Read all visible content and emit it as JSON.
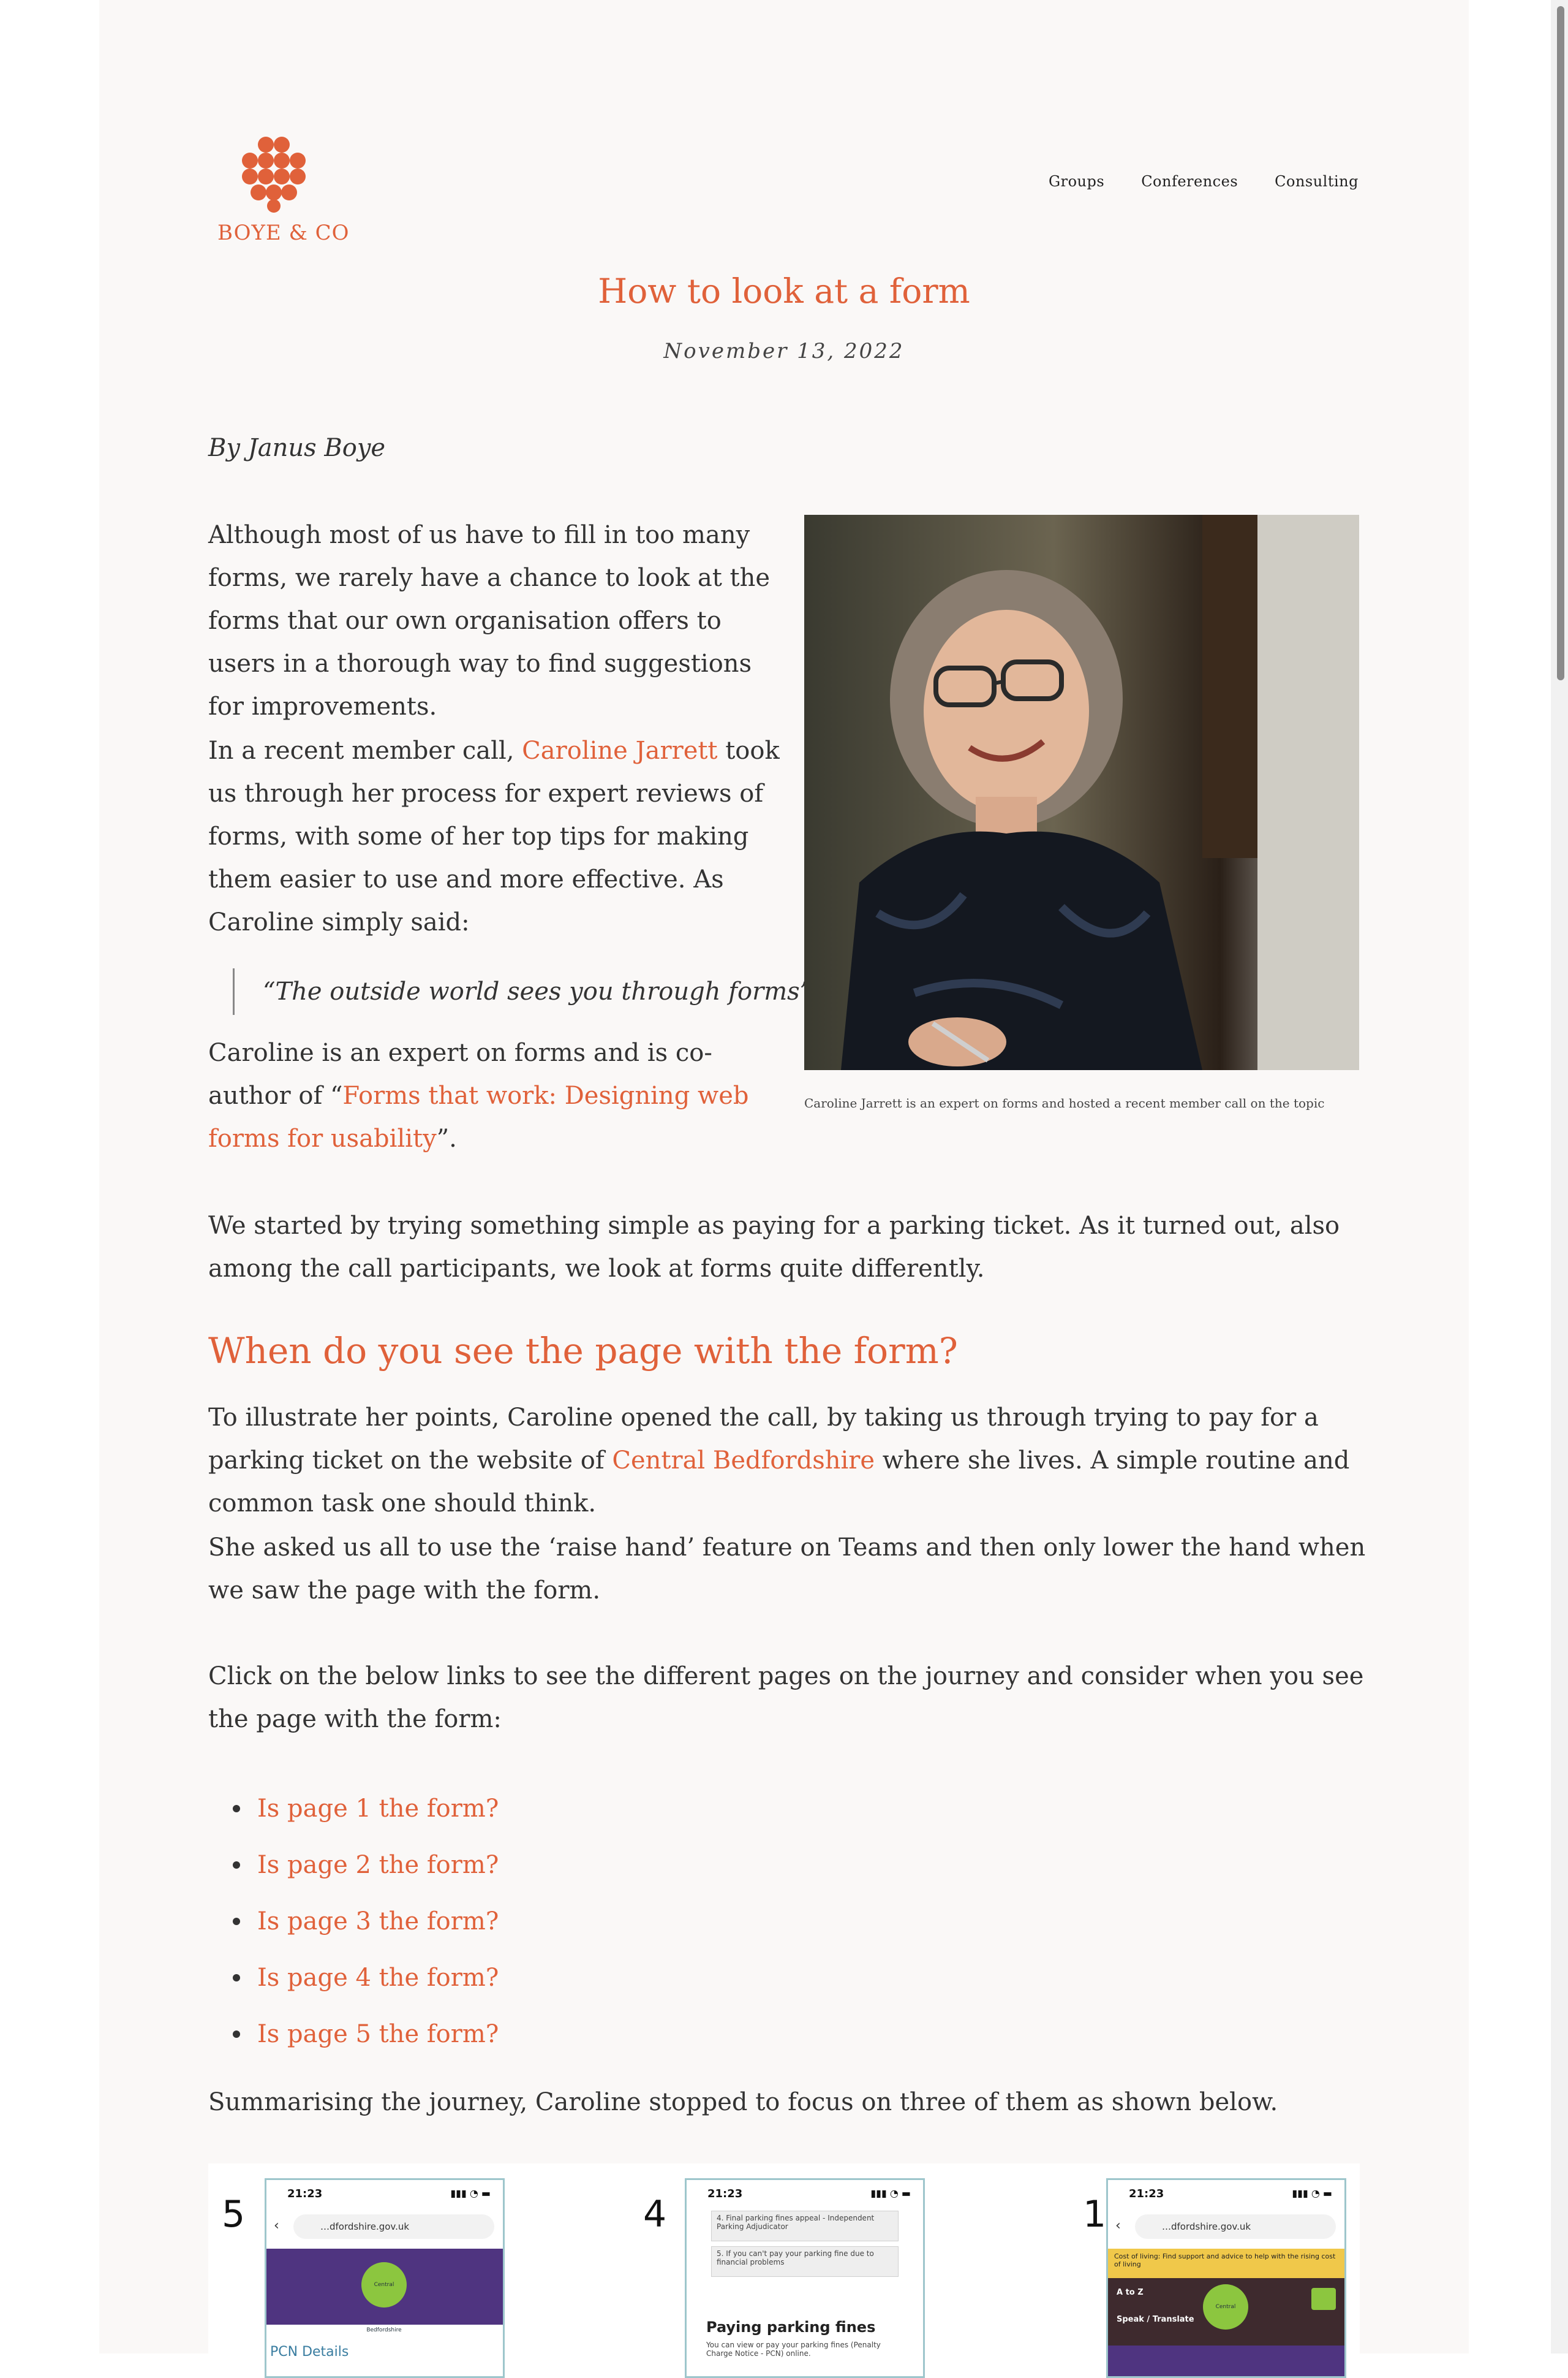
{
  "header": {
    "logo_text": "BOYE & CO",
    "nav": [
      "Groups",
      "Conferences",
      "Consulting"
    ]
  },
  "post": {
    "title": "How to look at a form",
    "date": "November 13, 2022",
    "byline": "By Janus Boye",
    "p1": "Although most of us have to fill in too many forms, we rarely have a chance to look at the forms that our own organisation offers to users in a thorough way to find suggestions for improvements.",
    "p2_before": "In a recent member call, ",
    "p2_link": "Caroline Jarrett",
    "p2_after": " took us through her process for expert reviews of forms, with some of her top tips for making them easier to use and more effective. As Caroline simply said:",
    "quote": "“The outside world sees you through forms”",
    "p3_before": "Caroline is an expert on forms and is co-author of “",
    "p3_link": "Forms that work: Designing web forms for usability",
    "p3_after": "”.",
    "photo_caption": "Caroline Jarrett is an expert on forms and hosted a recent member call on the topic",
    "p4": "We started by trying something simple as paying for a parking ticket. As it turned out, also among the call participants, we look at forms quite differently.",
    "section_heading": "When do you see the page with the form?",
    "p5_before": "To illustrate her points, Caroline opened the call, by taking us through trying to pay for a parking ticket on the website of ",
    "p5_link": "Central Bedfordshire",
    "p5_after": " where she lives. A simple routine and common task one should think.",
    "p6": "She asked us all to use the ‘raise hand’ feature on Teams and then only lower the hand when we saw the page with the form.",
    "p7": "Click on the below links to see the different pages on the journey and consider when you see the page with the form:",
    "links": [
      "Is page 1 the form?",
      "Is page 2 the form?",
      "Is page 3 the form?",
      "Is page 4 the form?",
      "Is page 5 the form?"
    ],
    "p8": "Summarising the journey, Caroline stopped to focus on three of them as shown below."
  },
  "screens": [
    {
      "number": "5",
      "time": "21:23",
      "url": "…dfordshire.gov.uk",
      "badge": "Central Bedfordshire",
      "subheading": "PCN Details"
    },
    {
      "number": "4",
      "time": "21:23",
      "item1": "4. Final parking fines appeal - Independent Parking Adjudicator",
      "item2": "5. If you can't pay your parking fine due to financial problems",
      "heading": "Paying parking fines",
      "text": "You can view or pay your parking fines (Penalty Charge Notice - PCN) online."
    },
    {
      "number": "1",
      "time": "21:23",
      "url": "…dfordshire.gov.uk",
      "notice": "Cost of living: Find support and advice to help with the rising cost of living",
      "atoz": "A to Z",
      "speak": "Speak / Translate",
      "badge": "Central Bedfordshire"
    }
  ],
  "colors": {
    "accent": "#e0613a",
    "page_bg": "#faf8f7",
    "text": "#333333"
  }
}
